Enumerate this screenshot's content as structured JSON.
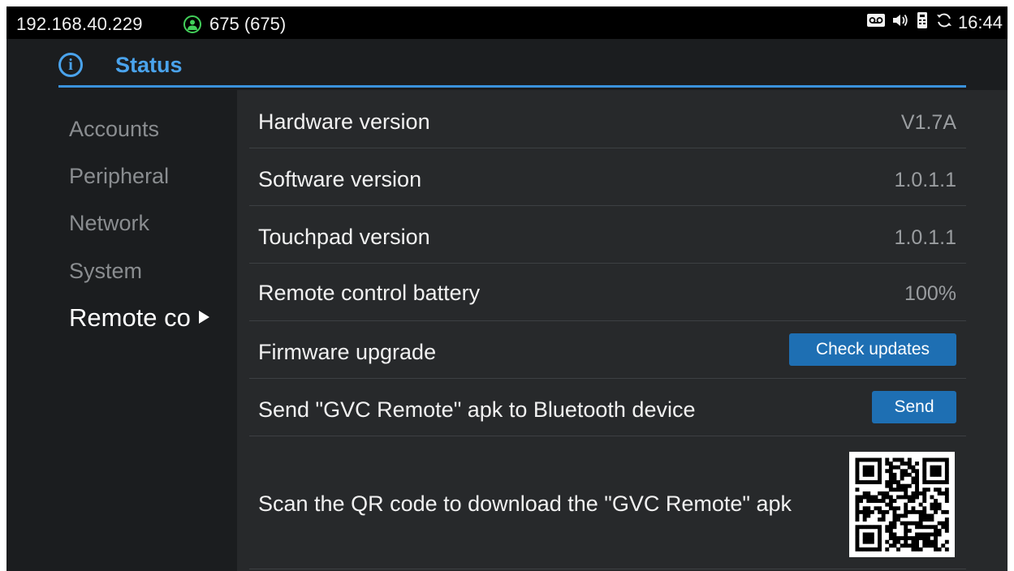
{
  "statusbar": {
    "ip": "192.168.40.229",
    "account_icon": "account-icon",
    "account": "675 (675)",
    "icons": [
      "voicemail-icon",
      "volume-icon",
      "remote-icon",
      "sync-icon"
    ],
    "time": "16:44"
  },
  "header": {
    "icon": "info-icon",
    "title": "Status"
  },
  "nav": {
    "items": [
      {
        "label": "Accounts"
      },
      {
        "label": "Peripheral"
      },
      {
        "label": "Network"
      },
      {
        "label": "System"
      },
      {
        "label": "Remote co"
      }
    ],
    "active_index": 4
  },
  "content": {
    "rows": [
      {
        "label": "Hardware version",
        "value": "V1.7A"
      },
      {
        "label": "Software version",
        "value": "1.0.1.1"
      },
      {
        "label": "Touchpad version",
        "value": "1.0.1.1"
      },
      {
        "label": "Remote control battery",
        "value": "100%"
      },
      {
        "label": "Firmware upgrade",
        "button": "Check updates"
      },
      {
        "label": "Send \"GVC Remote\" apk to Bluetooth device",
        "button": "Send"
      },
      {
        "label": "Scan the QR code to download the \"GVC Remote\" apk"
      }
    ]
  },
  "colors": {
    "accent": "#4aa3ec",
    "button": "#1e6fb3",
    "account_ok": "#42d05a",
    "background": "#1b1d1f",
    "panel": "#27292b"
  }
}
